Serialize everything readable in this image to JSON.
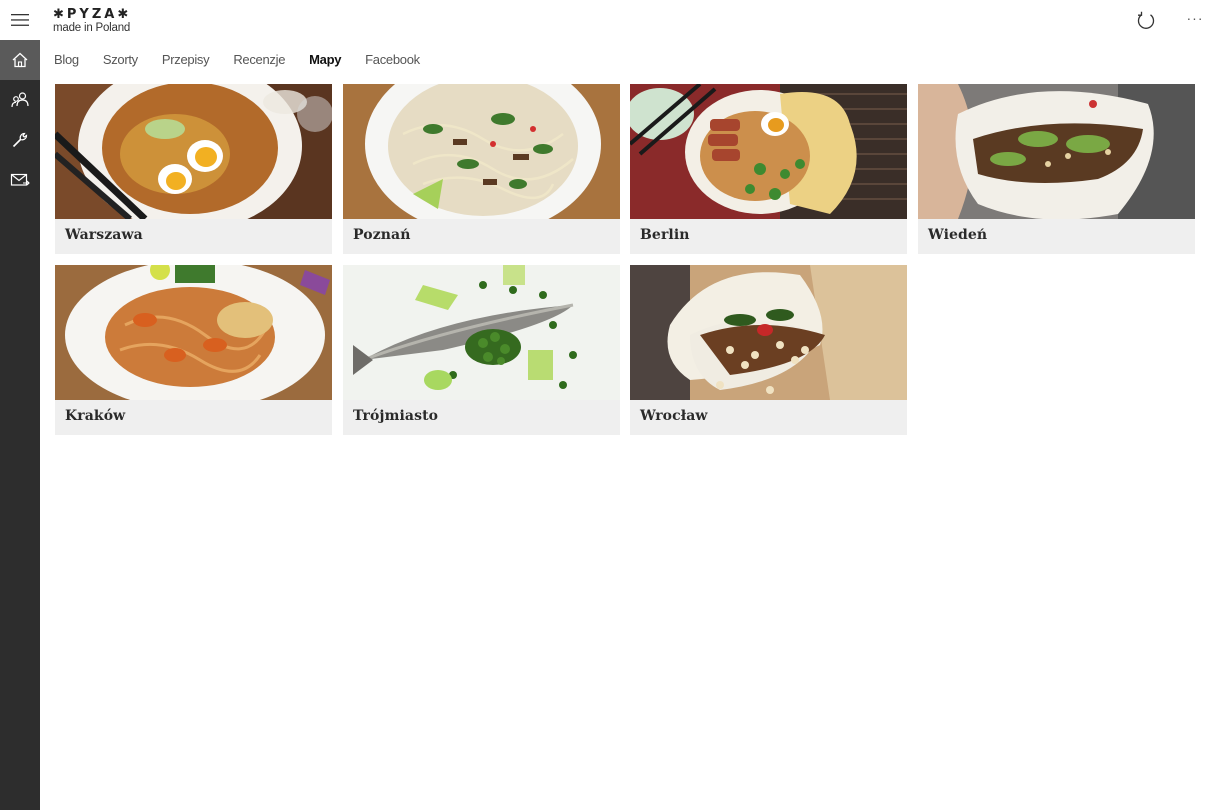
{
  "app": {
    "logo_top": "✱PYZA✱",
    "logo_bottom": "made in Poland"
  },
  "nav": {
    "items": [
      {
        "name": "home",
        "icon": "home-icon",
        "active": true
      },
      {
        "name": "people",
        "icon": "people-icon",
        "active": false
      },
      {
        "name": "tools",
        "icon": "wrench-icon",
        "active": false
      },
      {
        "name": "mail",
        "icon": "mail-icon",
        "active": false
      }
    ]
  },
  "titlebar": {
    "more_label": "···"
  },
  "tabs": [
    {
      "label": "Blog",
      "active": false
    },
    {
      "label": "Szorty",
      "active": false
    },
    {
      "label": "Przepisy",
      "active": false
    },
    {
      "label": "Recenzje",
      "active": false
    },
    {
      "label": "Mapy",
      "active": true
    },
    {
      "label": "Facebook",
      "active": false
    }
  ],
  "tiles": [
    {
      "label": "Warszawa"
    },
    {
      "label": "Poznań"
    },
    {
      "label": "Berlin"
    },
    {
      "label": "Wiedeń"
    },
    {
      "label": "Kraków"
    },
    {
      "label": "Trójmiasto"
    },
    {
      "label": "Wrocław"
    }
  ],
  "colors": {
    "rail": "#2d2d2d",
    "rail_active": "#5a5a5a",
    "tile_bg": "#efefef"
  }
}
